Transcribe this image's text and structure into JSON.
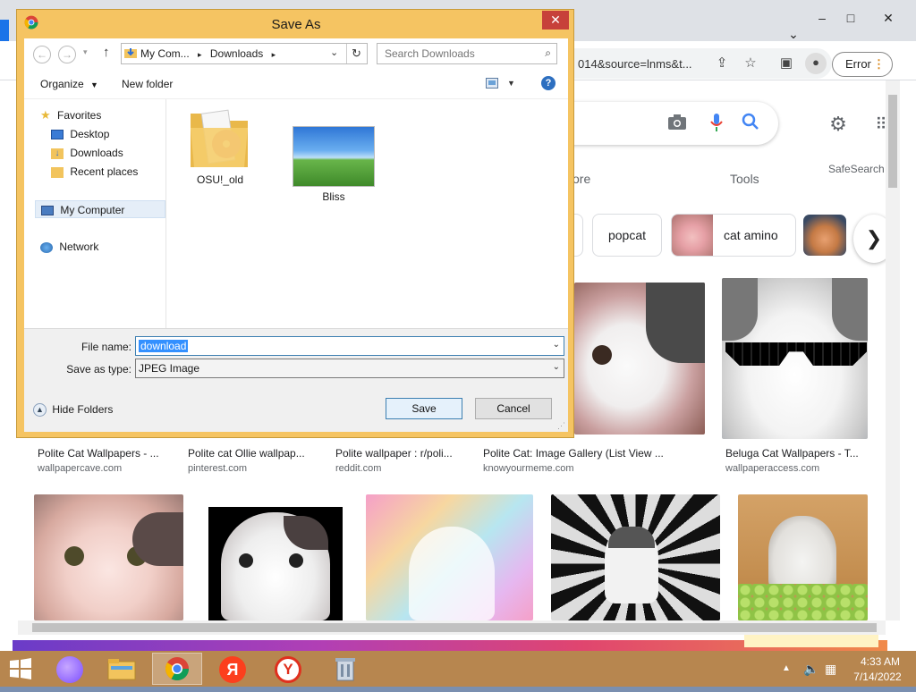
{
  "chrome": {
    "window_controls": {
      "minimize": "–",
      "maximize": "□",
      "close": "✕",
      "tabs_menu": "⌄"
    },
    "address_text": "014&source=lnms&t...",
    "error_label": "Error",
    "search_tabs": {
      "more": "ore",
      "tools": "Tools",
      "safesearch": "SafeSearch"
    },
    "chips": [
      "popcat",
      "cat amino"
    ],
    "results_row1": [
      {
        "title": "Polite Cat Wallpapers - ...",
        "source": "wallpapercave.com"
      },
      {
        "title": "Polite cat Ollie wallpap...",
        "source": "pinterest.com"
      },
      {
        "title": "Polite wallpaper : r/poli...",
        "source": "reddit.com"
      },
      {
        "title": "Polite Cat: Image Gallery (List View ...",
        "source": "knowyourmeme.com"
      },
      {
        "title": "Beluga Cat Wallpapers - T...",
        "source": "wallpaperaccess.com"
      }
    ]
  },
  "dialog": {
    "title": "Save As",
    "close": "✕",
    "breadcrumb": [
      "My Com...",
      "Downloads"
    ],
    "search_placeholder": "Search Downloads",
    "toolbar": {
      "organize": "Organize",
      "new_folder": "New folder",
      "help": "?"
    },
    "nav_pane": {
      "favorites": "Favorites",
      "favorites_items": [
        "Desktop",
        "Downloads",
        "Recent places"
      ],
      "my_computer": "My Computer",
      "network": "Network"
    },
    "files": [
      {
        "name": "OSU!_old",
        "kind": "folder"
      },
      {
        "name": "Bliss",
        "kind": "image"
      }
    ],
    "file_name_label": "File name:",
    "file_name_value": "download",
    "save_type_label": "Save as type:",
    "save_type_value": "JPEG Image",
    "hide_folders": "Hide Folders",
    "save_button": "Save",
    "cancel_button": "Cancel"
  },
  "taskbar": {
    "time": "4:33 AM",
    "date": "7/14/2022"
  }
}
